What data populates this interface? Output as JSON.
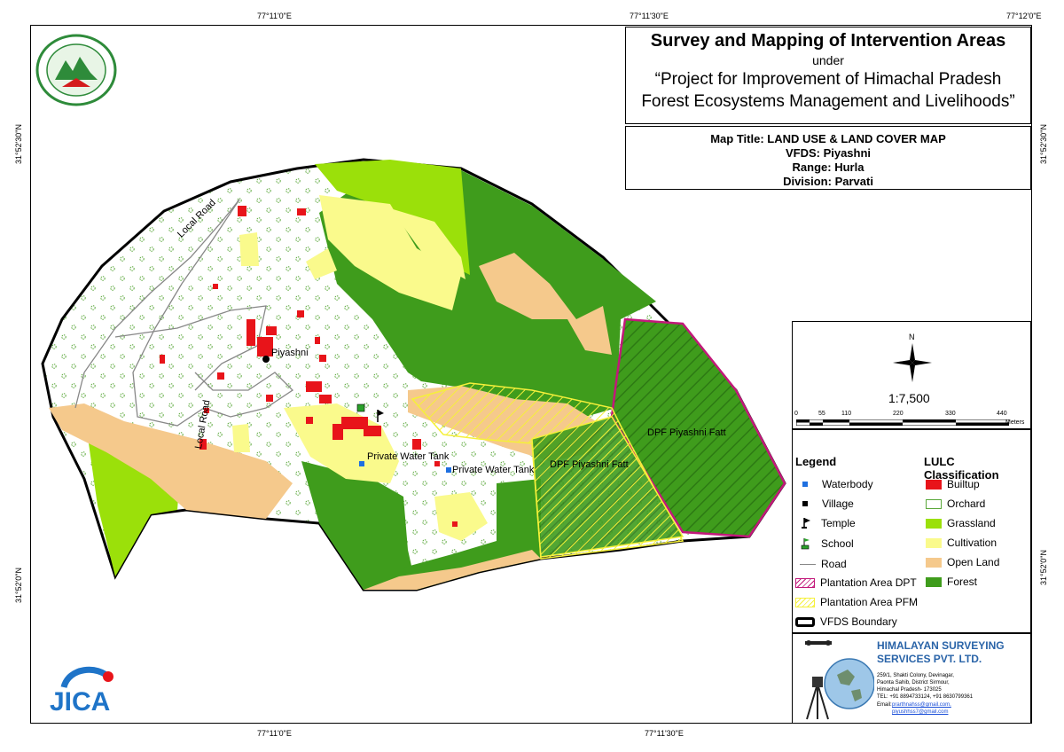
{
  "header": {
    "title": "Survey and Mapping of Intervention Areas",
    "under": "under",
    "project_line1": "“Project for Improvement of Himachal Pradesh",
    "project_line2": "Forest Ecosystems Management and Livelihoods”"
  },
  "map_info": {
    "map_title": "Map Title: LAND USE & LAND COVER MAP",
    "vfds": "VFDS: Piyashni",
    "range": "Range: Hurla",
    "division": "Division: Parvati"
  },
  "coords": {
    "top": [
      "77°11'0\"E",
      "77°11'30\"E",
      "77°12'0\"E"
    ],
    "bottom": [
      "77°11'0\"E",
      "77°11'30\"E"
    ],
    "left": [
      "31°52'30\"N",
      "31°52'0\"N"
    ],
    "right": [
      "31°52'30\"N",
      "31°52'0\"N"
    ]
  },
  "scale": {
    "north": "N",
    "ratio": "1:7,500",
    "ticks": [
      "0",
      "55",
      "110",
      "220",
      "330",
      "440"
    ],
    "unit": "Meters"
  },
  "legend": {
    "heading": "Legend",
    "items": [
      "Waterbody",
      "Village",
      "Temple",
      "School",
      "Road",
      "Plantation Area DPT",
      "Plantation Area PFM",
      "VFDS Boundary"
    ]
  },
  "lulc": {
    "heading": "LULC Classification",
    "items": [
      {
        "label": "Builtup",
        "color": "#e8141a"
      },
      {
        "label": "Orchard",
        "color": "#ffffff"
      },
      {
        "label": "Grassland",
        "color": "#9be00a"
      },
      {
        "label": "Cultivation",
        "color": "#fafa8c"
      },
      {
        "label": "Open Land",
        "color": "#f5c98c"
      },
      {
        "label": "Forest",
        "color": "#3f9c1c"
      }
    ]
  },
  "map_labels": {
    "local_road_1": "Local Road",
    "local_road_2": "Local Road",
    "village": "Piyashni",
    "tank_1": "Private Water Tank",
    "tank_2": "Private Water Tank",
    "dpf_1": "DPF Piyashni Fatt",
    "dpf_2": "DPF Piyashni Fatt"
  },
  "company": {
    "name_line1": "HIMALAYAN SURVEYING",
    "name_line2": "SERVICES PVT. LTD.",
    "address1": "259/1, Shakti Colony, Devinagar,",
    "address2": "Paonta Sahib, District Sirmour,",
    "address3": "Himachal Pradesh- 173025",
    "tel": "TEL: +91 8894733124, +91 8630799361",
    "email_label": "Email:",
    "email1": "prarthnahss@gmail.com,",
    "email2": "piyushhss7@gmail.com"
  },
  "logos": {
    "top_left_seal": "Himachal Pradesh Forest Department seal",
    "bottom_left": "JICA"
  }
}
